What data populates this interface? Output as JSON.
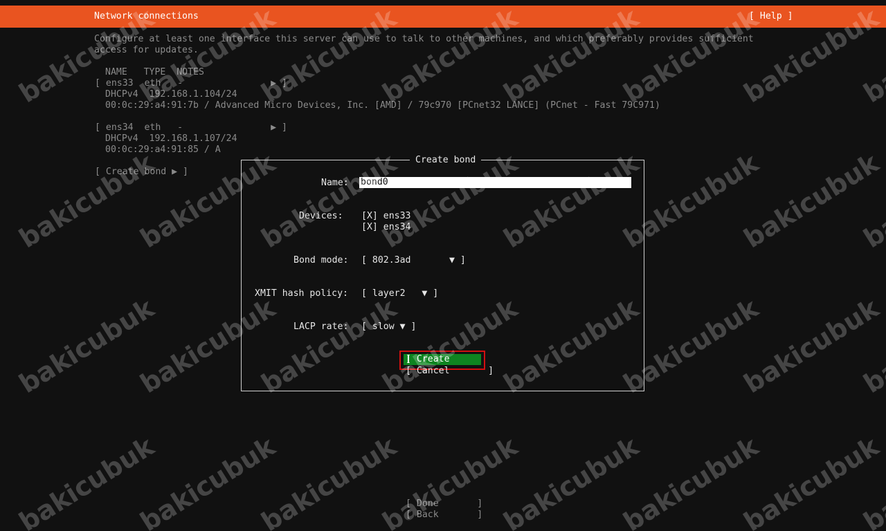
{
  "header": {
    "title": "Network connections",
    "help": "[ Help ]"
  },
  "intro": {
    "line1": "Configure at least one interface this server can use to talk to other machines, and which preferably provides sufficient",
    "line2": "access for updates."
  },
  "table": {
    "columns": "NAME   TYPE  NOTES",
    "interfaces": [
      {
        "row": "[ ens33  eth   -                ▶ ]",
        "addr": "DHCPv4  192.168.1.104/24",
        "hw": "00:0c:29:a4:91:7b / Advanced Micro Devices, Inc. [AMD] / 79c970 [PCnet32 LANCE] (PCnet - Fast 79C971)"
      },
      {
        "row": "[ ens34  eth   -                ▶ ]",
        "addr": "DHCPv4  192.168.1.107/24",
        "hw": "00:0c:29:a4:91:85 / A"
      }
    ],
    "create_bond": "[ Create bond ▶ ]"
  },
  "dialog": {
    "title": "Create bond",
    "name_label": "Name:",
    "name_value": "bond0",
    "devices_label": "Devices:",
    "devices": [
      "[X] ens33",
      "[X] ens34"
    ],
    "bond_mode_label": "Bond mode:",
    "bond_mode": "[ 802.3ad       ▼ ]",
    "xmit_label": "XMIT hash policy:",
    "xmit": "[ layer2   ▼ ]",
    "lacp_label": "LACP rate:",
    "lacp": "[ slow ▼ ]",
    "create_label": "[ Create",
    "create_close": "]",
    "cancel": "[ Cancel       ]"
  },
  "footer": {
    "done": "[ Done       ]",
    "back": "[ Back       ]"
  },
  "watermark": "bakicubuk",
  "colors": {
    "titlebar": "#e95420",
    "background": "#111111",
    "create_button": "#0e8420",
    "highlight": "#d01010"
  }
}
